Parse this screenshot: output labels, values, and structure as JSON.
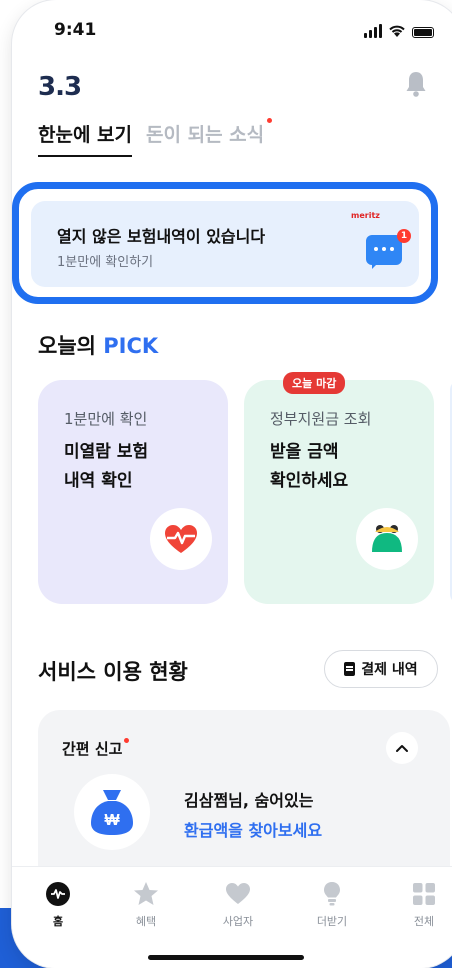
{
  "status": {
    "time": "9:41"
  },
  "header": {
    "logo_text": "3.3"
  },
  "tabs": [
    {
      "label": "한눈에 보기",
      "active": true
    },
    {
      "label": "돈이 되는 소식",
      "active": false,
      "has_dot": true
    }
  ],
  "banner": {
    "title": "열지 않은 보험내역이 있습니다",
    "subtitle": "1분만에 확인하기",
    "brand_text": "meritz",
    "badge_count": "1"
  },
  "pick": {
    "title_prefix": "오늘의 ",
    "title_highlight": "PICK",
    "cards": [
      {
        "subtitle": "1분만에 확인",
        "title_line1": "미열람 보험",
        "title_line2": "내역 확인",
        "icon": "heart-pulse-icon"
      },
      {
        "badge": "오늘 마감",
        "subtitle": "정부지원금 조회",
        "title_line1": "받을 금액",
        "title_line2": "확인하세요",
        "icon": "coin-purse-icon"
      }
    ]
  },
  "service": {
    "title": "서비스 이용 현황",
    "payment_button": "결제 내역",
    "simple_report": {
      "title": "간편 신고",
      "message_line1": "김삼쩜님, 숨어있는",
      "message_line2": "환급액을 찾아보세요"
    }
  },
  "nav": [
    {
      "label": "홈",
      "icon": "home-icon",
      "active": true
    },
    {
      "label": "혜택",
      "icon": "star-icon",
      "active": false
    },
    {
      "label": "사업자",
      "icon": "heart-icon",
      "active": false
    },
    {
      "label": "더받기",
      "icon": "lightbulb-icon",
      "active": false
    },
    {
      "label": "전체",
      "icon": "grid-icon",
      "active": false
    }
  ],
  "colors": {
    "accent_blue": "#2f6ff0",
    "highlight_border": "#1f6ff0",
    "deadline_red": "#e53935",
    "logo_navy": "#1e2d50"
  }
}
